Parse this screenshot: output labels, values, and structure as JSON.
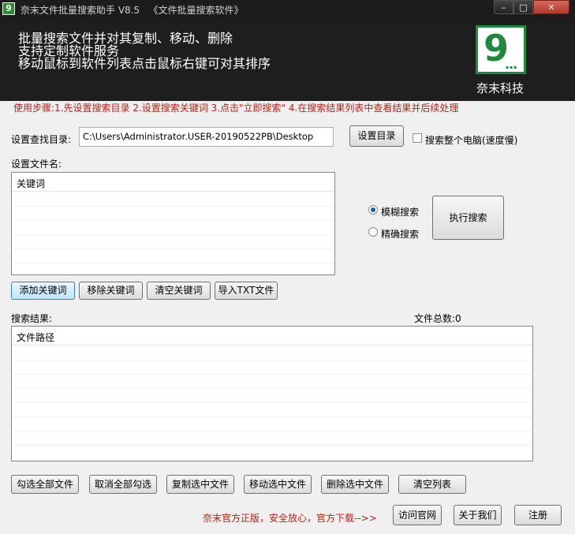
{
  "window": {
    "title": "奈末文件批量搜索助手 V8.5   《文件批量搜索软件》",
    "controls": {
      "minimize": "–",
      "maximize": "□",
      "close": "✕"
    }
  },
  "banner": {
    "lines": [
      "批量搜索文件并对其复制、移动、删除",
      "支持定制软件服务",
      "移动鼠标到软件列表点击鼠标右键可对其排序"
    ],
    "logo_mark": "9",
    "logo_dots": "...",
    "logo_caption": "奈末科技"
  },
  "steps": "使用步骤:1.先设置搜索目录 2.设置搜索关键词 3.点击\"立即搜索\" 4.在搜索结果列表中查看结果并后续处理",
  "directory": {
    "label": "设置查找目录:",
    "value": "C:\\Users\\Administrator.USER-20190522PB\\Desktop",
    "set_button": "设置目录",
    "whole_pc_label": "搜索整个电脑(速度慢)"
  },
  "filename": {
    "label": "设置文件名:",
    "column": "关键词"
  },
  "search_mode": {
    "fuzzy": "模糊搜索",
    "exact": "精确搜索",
    "selected": "fuzzy",
    "run_button": "执行搜索"
  },
  "keyword_buttons": {
    "add": "添加关键词",
    "remove": "移除关键词",
    "clear": "清空关键词",
    "import": "导入TXT文件"
  },
  "results": {
    "label": "搜索结果:",
    "count_label": "文件总数:0",
    "column": "文件路径"
  },
  "result_buttons": {
    "select_all": "勾选全部文件",
    "deselect_all": "取消全部勾选",
    "copy": "复制选中文件",
    "move": "移动选中文件",
    "delete": "删除选中文件",
    "clear": "清空列表"
  },
  "footer": {
    "note": "奈末官方正版，安全放心，官方下载-->>",
    "website": "访问官网",
    "about": "关于我们",
    "register": "注册"
  }
}
